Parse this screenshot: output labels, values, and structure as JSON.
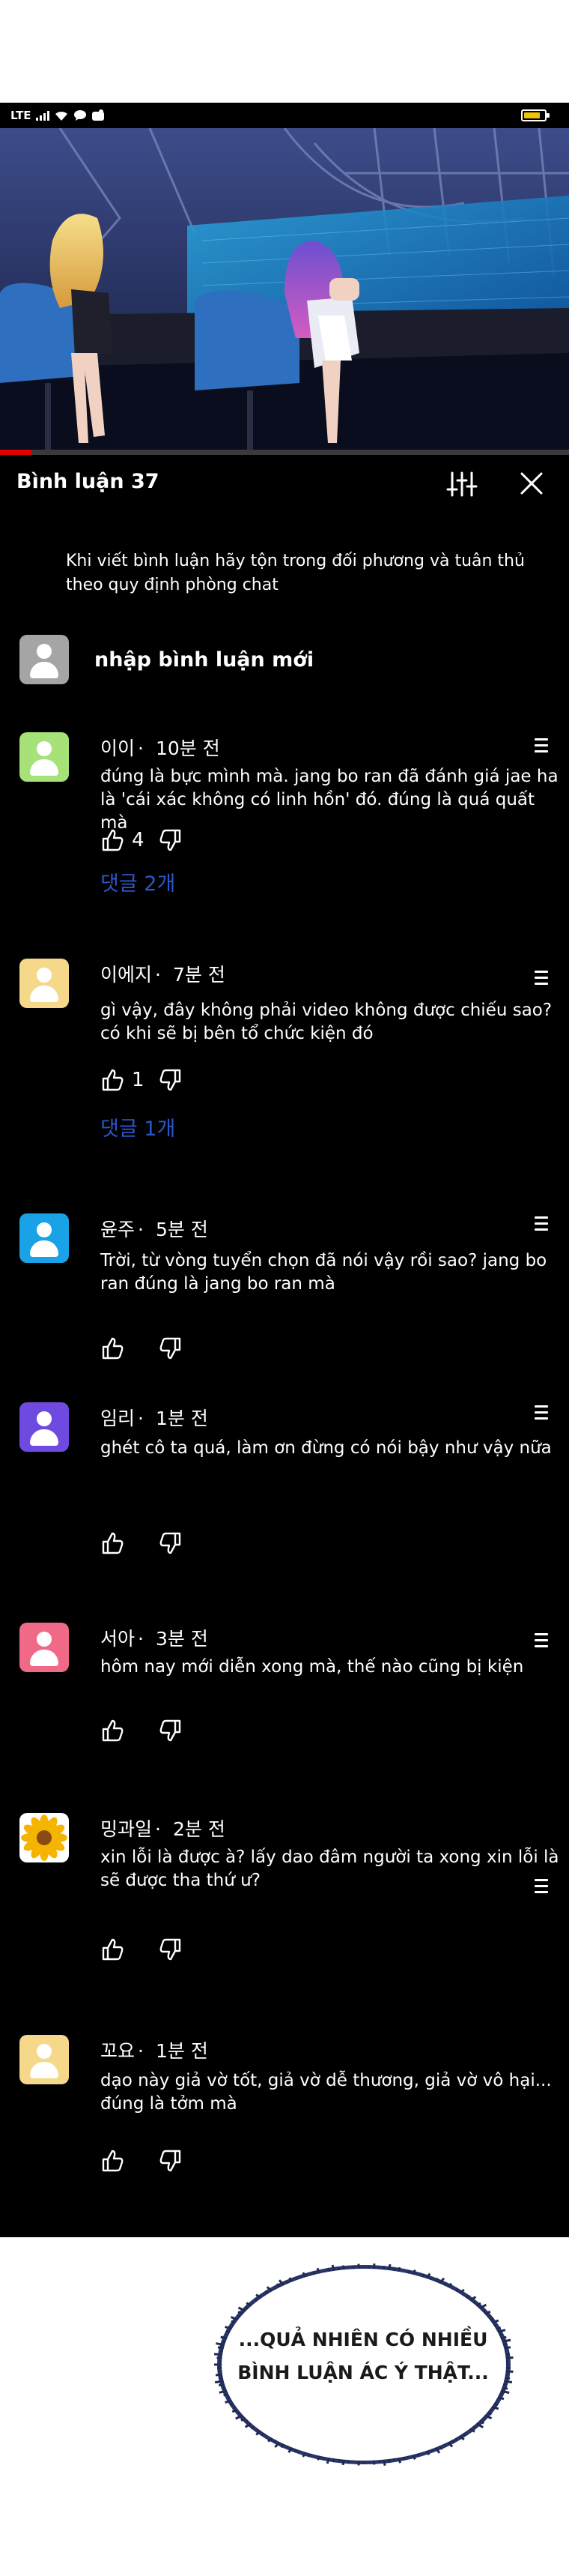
{
  "status_bar": {
    "network": "LTE",
    "battery_level": 0.8,
    "battery_color": "#f2c500"
  },
  "video": {
    "progress": 0.055,
    "progress_color": "#e00000"
  },
  "comments_panel": {
    "title": "Bình luận 37",
    "filter_icon": "sliders-icon",
    "close_icon": "close-icon",
    "notice": "Khi viết bình luận hãy tộn trong đối phương và tuân thủ theo quy định phòng chat",
    "new_comment_placeholder": "nhập bình luận mới",
    "reply_link_color": "#2c56c9",
    "comments": [
      {
        "author": "이이",
        "time": "10분 전",
        "text": "đúng là bực mình mà. jang bo ran đã đánh giá jae ha là 'cái xác không có linh hồn' đó. đúng là quá quất mà",
        "likes": "4",
        "replies": "댓글 2개",
        "avatar_color": "#a6e277"
      },
      {
        "author": "이에지",
        "time": "7분 전",
        "text": "gì vậy, đây không phải video không được chiếu sao? có khi sẽ bị bên tổ chức kiện đó",
        "likes": "1",
        "replies": "댓글 1개",
        "avatar_color": "#f5d88a"
      },
      {
        "author": "윤주",
        "time": "5분 전",
        "text": "Trời, từ vòng tuyển chọn đã nói vậy rồi sao? jang bo ran đúng là jang bo ran mà",
        "avatar_color": "#1aa2e6"
      },
      {
        "author": "임리",
        "time": "1분 전",
        "text": "ghét cô ta quá, làm ơn đừng có nói bậy như vậy nữa",
        "avatar_color": "#6f4ae0"
      },
      {
        "author": "서아",
        "time": "3분 전",
        "text": "hôm nay mới diễn xong mà, thế nào cũng bị kiện",
        "avatar_color": "#f06a87"
      },
      {
        "author": "밍과일",
        "time": "2분 전",
        "text": "xin lỗi là được à? lấy dao đâm người ta xong xin lỗi là sẽ được tha thứ ư?",
        "avatar_color": "#ffffff",
        "avatar_icon": "sunflower-icon"
      },
      {
        "author": "꼬요",
        "time": "1분 전",
        "text": "dạo này giả vờ tốt, giả vờ dễ thương, giả vờ vô hại... đúng là tởm mà",
        "avatar_color": "#f5d88a"
      }
    ],
    "user_avatar_color": "#a5a5a5"
  },
  "speech_bubble": {
    "line1": "...QUẢ NHIÊN CÓ NHIỀU",
    "line2": "BÌNH LUẬN ÁC Ý THẬT..."
  }
}
